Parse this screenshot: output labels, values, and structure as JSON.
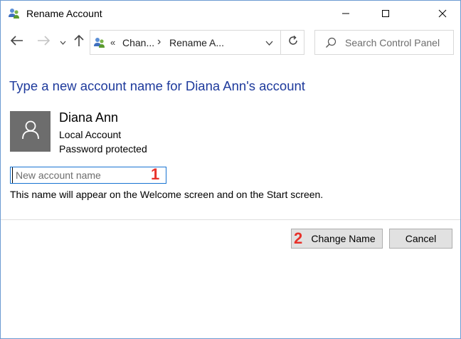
{
  "window": {
    "title": "Rename Account"
  },
  "nav": {
    "address_separator": "«",
    "breadcrumbs": [
      "Chan...",
      "Rename A..."
    ],
    "breadcrumb_sep": "›",
    "search_placeholder": "Search Control Panel"
  },
  "content": {
    "heading": "Type a new account name for Diana Ann's account",
    "user": {
      "name": "Diana Ann",
      "account_type": "Local Account",
      "password_status": "Password protected"
    },
    "name_input_placeholder": "New account name",
    "hint": "This name will appear on the Welcome screen and on the Start screen."
  },
  "annotations": {
    "marker_1": "1",
    "marker_2": "2"
  },
  "buttons": {
    "change_name": "Change Name",
    "cancel": "Cancel"
  },
  "colors": {
    "heading": "#1e3a9c",
    "input_border": "#1874d2",
    "marker": "#e8312a",
    "avatar_bg": "#6d6d6d"
  },
  "icons": {
    "app": "user-accounts-icon",
    "back": "back-arrow-icon",
    "forward": "forward-arrow-icon",
    "recent": "chevron-down-icon",
    "up": "up-arrow-icon",
    "refresh": "refresh-icon",
    "search": "search-icon",
    "avatar": "user-avatar-icon"
  }
}
